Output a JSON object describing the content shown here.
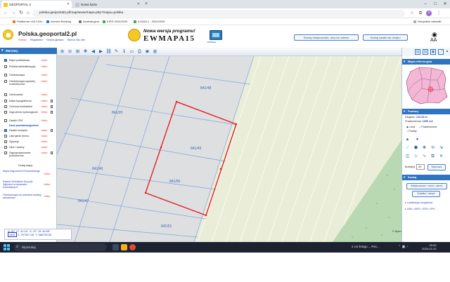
{
  "browser": {
    "tabs": [
      {
        "label": "GEOPORTAL 2",
        "active": true
      },
      {
        "label": "Nowa karta",
        "active": false
      }
    ],
    "new_tab": "+",
    "url": "polska.geoportal2.pl/map/www/mapa.php?mapa=polska",
    "bookmarks": [
      "Plattforma VULCAN...",
      "Internet Banking",
      "Abstrakcyjna",
      "KIDS 2024/2025",
      "KLASA 2 - 2024/2025"
    ],
    "all_bookmarks": "Wszystkie zakładki"
  },
  "site": {
    "title": "Polska.geoportal2.pl",
    "nav_links": [
      "Pomoc",
      "Regulamin",
      "Strona główna",
      "Strona Gis-Info"
    ],
    "banner_line1": "Nowa wersja programu!",
    "banner_line2": "EWMAPA15",
    "banner_sub": "EWMapa",
    "btn_search_address": "Szukaj miejscowości, ulicy lub adresu",
    "btn_search_parcel": "Szukaj działki lub obrębu",
    "font_size_label": "AA"
  },
  "left_panel": {
    "header": "Warstwy",
    "layers": [
      {
        "name": "Mapa podkładowa",
        "checked": true,
        "info": "<Info>",
        "caret": false
      },
      {
        "name": "Podział administracyjny",
        "checked": false,
        "info": "<Info>",
        "caret": true
      },
      {
        "name": "Ortofotomapa",
        "checked": false,
        "info": "<Info>",
        "caret": false
      },
      {
        "name": "Ortofotomapa wysokiej rozdzielczości",
        "checked": false,
        "info": "<Info>",
        "caret": false
      },
      {
        "name": "Cieniowanie",
        "checked": false,
        "info": "<Info>",
        "caret": false
      },
      {
        "name": "Mapa topograficzna",
        "checked": false,
        "info": "<Info>",
        "caret": true
      },
      {
        "name": "Ochrona środowiska",
        "checked": false,
        "info": "<Info>",
        "caret": true
      },
      {
        "name": "Zagrożenia hydrologiczne",
        "checked": false,
        "info": "<Info>",
        "caret": true
      },
      {
        "name": "Działki LPIS",
        "checked": false,
        "info": "<Info>",
        "caret": false
      },
      {
        "name": "Działki i budynki",
        "checked": true,
        "info": "<Info>",
        "caret": true
      },
      {
        "name": "Uzbrojenie terenu",
        "checked": false,
        "info": "<Info>",
        "caret": true
      },
      {
        "name": "Sytuacja",
        "checked": false,
        "info": "<Info>",
        "caret": false
      },
      {
        "name": "Ulice i adresy",
        "checked": false,
        "info": "<Info>",
        "caret": true
      },
      {
        "name": "Zagospodarowanie przestrzenne",
        "checked": false,
        "info": "<Info>",
        "caret": true
      }
    ],
    "sub_label": "Dane powiatowe/gminne",
    "add_map": "Dodaj mapy",
    "extra_links": [
      {
        "label": "Mapa Zagrożenia Powodziowego",
        "info": "<Info>"
      },
      {
        "label": "Rejestr Wniosków Decyzji i Zgłoszeń w sprawach budowlanych",
        "info": "<Info>"
      },
      {
        "label": "Ortofotomapa do pobrania według aktualności",
        "info": "<Info>"
      }
    ],
    "footer_link": "Zmiana kolejności i przezroczystości"
  },
  "map": {
    "tool_icons": [
      "zoom-in",
      "zoom-out",
      "zoom-box",
      "pan",
      "back",
      "forward",
      "link",
      "info",
      "measure",
      "print",
      "camera",
      "globe",
      "settings"
    ],
    "parcel_labels": [
      "841/48",
      "841/20",
      "841/49",
      "841/40",
      "841/50",
      "841/47",
      "841/51"
    ],
    "coords": {
      "lat": "N: 50° 27' 42.16\"",
      "lon": "E: 20° 15' 46.85\"",
      "sys": "1992",
      "x": "X: 297537.08",
      "y": "Y: 588759.55"
    },
    "attribution": "© OpenStreetMap contributors",
    "colors": {
      "parcel_fill": "#dedfe1",
      "field": "#eaedd8",
      "selection": "#e8121e",
      "forest": "#b9d9b2"
    }
  },
  "right_panel": {
    "ref_header": "Mapa referencyjna",
    "params_header": "Pomiary",
    "length_label": "Długość:",
    "length_value": "123.45 m",
    "area_label": "Powierzchnia:",
    "area_value": "1050 m2",
    "measure_options": [
      "Linia",
      "Powierzchnia",
      "Punkty"
    ],
    "selected_option": "Linia",
    "buffer_label": "Bufor[m]",
    "buffer_value": "20",
    "buffer_btn": "Wyznacz",
    "search_header": "Szukaj",
    "btn_place": "Miejscowość / ulica / adres",
    "btn_parcel": "Działka / obręb",
    "link_locate": "Lokalizacja urządzenia",
    "link_gml": "GML / WFS / GSD / GPX"
  },
  "taskbar": {
    "search_placeholder": "Wyszukaj",
    "weather": "2 cm śniegu ... Pon...",
    "time": "09:08",
    "date": "2025-02-10"
  }
}
